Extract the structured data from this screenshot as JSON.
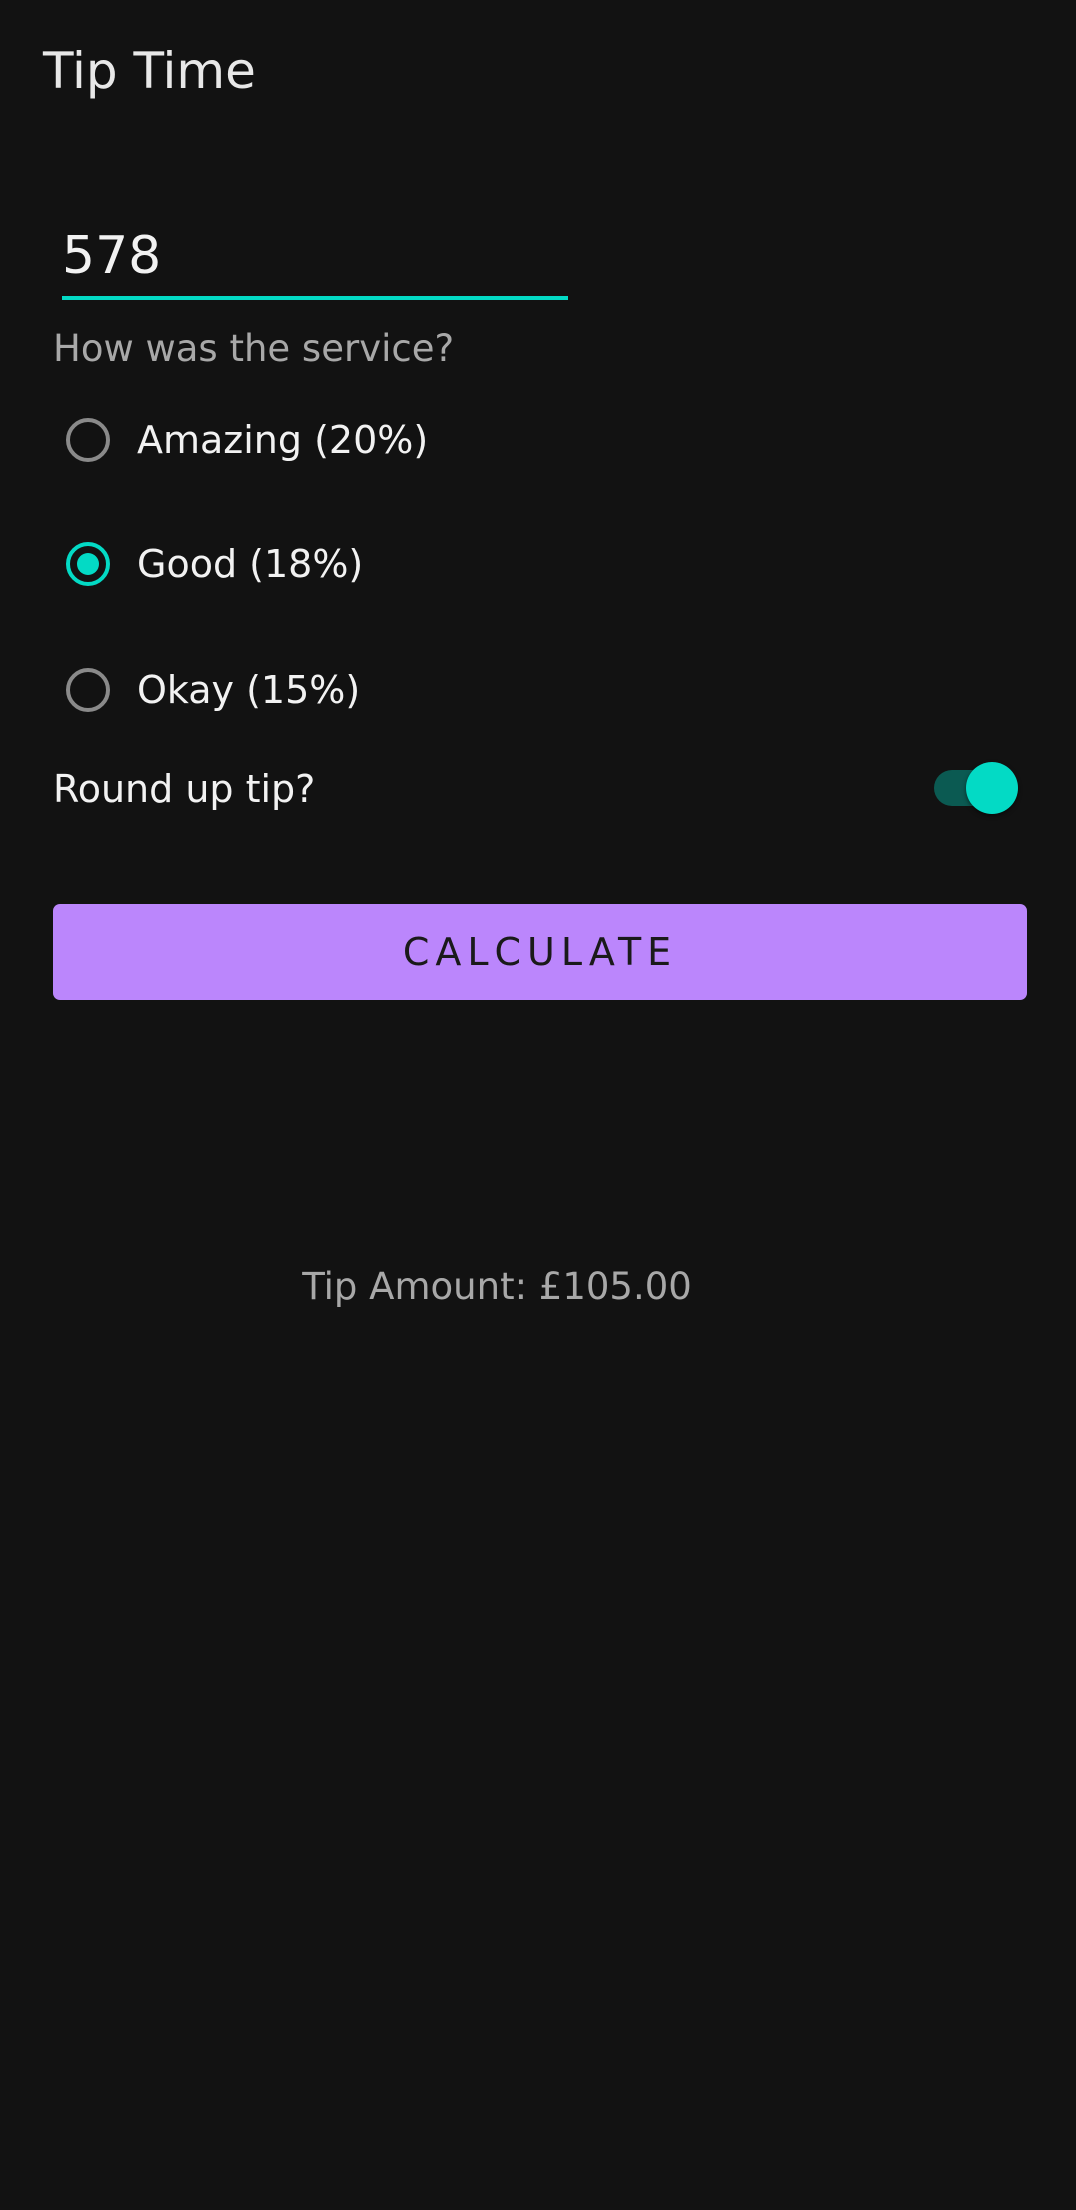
{
  "app": {
    "title": "Tip Time"
  },
  "cost_of_service": {
    "value": "578"
  },
  "service_question": "How was the service?",
  "tip_options": [
    {
      "label": "Amazing (20%)",
      "selected": false
    },
    {
      "label": "Good (18%)",
      "selected": true
    },
    {
      "label": "Okay (15%)",
      "selected": false
    }
  ],
  "round_up": {
    "label": "Round up tip?",
    "enabled": true
  },
  "calculate_button": {
    "label": "CALCULATE"
  },
  "result": {
    "text": "Tip Amount: £105.00"
  },
  "colors": {
    "background": "#121212",
    "accent": "#03dac5",
    "primary": "#bb86fc"
  }
}
